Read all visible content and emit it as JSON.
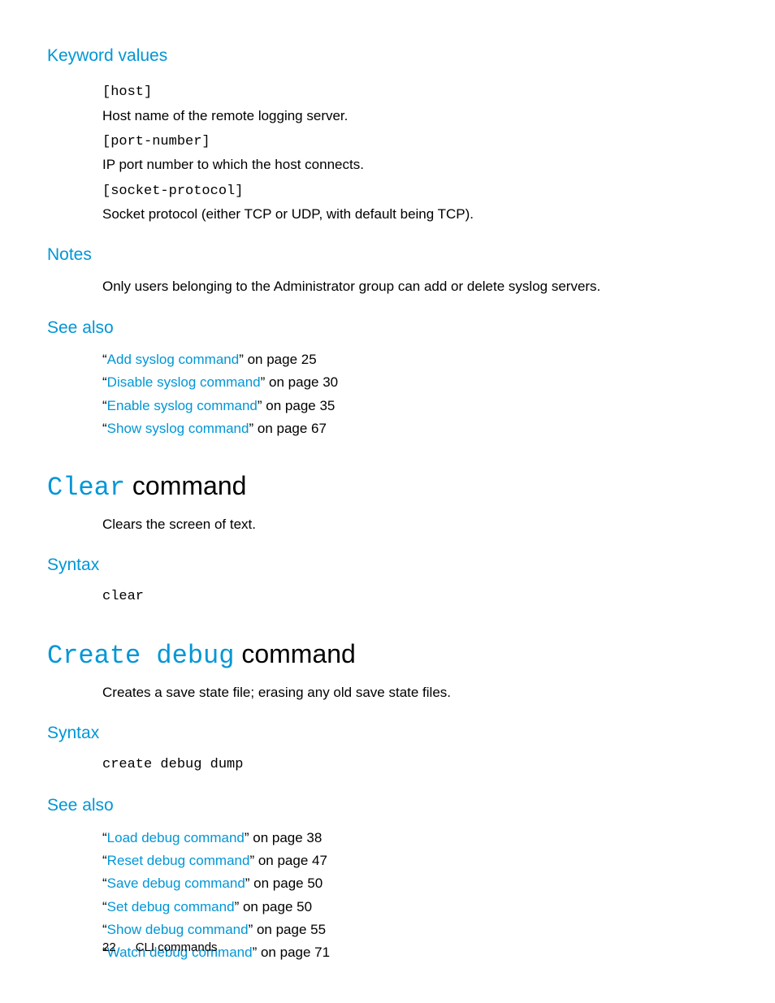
{
  "sections": {
    "keyword_values": {
      "heading": "Keyword values",
      "items": [
        {
          "keyword": "[host]",
          "desc": "Host name of the remote logging server."
        },
        {
          "keyword": "[port-number]",
          "desc": "IP port number to which the host connects."
        },
        {
          "keyword": "[socket-protocol]",
          "desc": "Socket protocol (either TCP or UDP, with default being TCP)."
        }
      ]
    },
    "notes": {
      "heading": "Notes",
      "text": "Only users belonging to the Administrator group can add or delete syslog servers."
    },
    "see_also_1": {
      "heading": "See also",
      "refs": [
        {
          "q1": "“",
          "link": "Add syslog command",
          "tail": "” on page 25"
        },
        {
          "q1": "“",
          "link": "Disable syslog command",
          "tail": "” on page 30"
        },
        {
          "q1": "“",
          "link": "Enable syslog command",
          "tail": "” on page 35"
        },
        {
          "q1": "“",
          "link": "Show syslog command",
          "tail": "” on page 67"
        }
      ]
    },
    "clear_cmd": {
      "title_mono": "Clear",
      "title_rest": " command",
      "desc": "Clears the screen of text.",
      "syntax_heading": "Syntax",
      "syntax_code": "clear"
    },
    "create_debug_cmd": {
      "title_mono": "Create debug",
      "title_rest": " command",
      "desc": "Creates a save state file; erasing any old save state files.",
      "syntax_heading": "Syntax",
      "syntax_code": "create debug dump",
      "see_also_heading": "See also",
      "refs": [
        {
          "q1": "“",
          "link": "Load debug command",
          "tail": "” on page 38"
        },
        {
          "q1": "“",
          "link": "Reset debug command",
          "tail": "” on page 47"
        },
        {
          "q1": "“",
          "link": "Save debug command",
          "tail": "” on page 50"
        },
        {
          "q1": "“",
          "link": "Set debug command",
          "tail": "” on page 50"
        },
        {
          "q1": "“",
          "link": "Show debug command",
          "tail": "” on page 55"
        },
        {
          "q1": "“",
          "link": "Watch debug command",
          "tail": "” on page 71"
        }
      ]
    }
  },
  "footer": {
    "page_num": "22",
    "running": "CLI commands"
  }
}
